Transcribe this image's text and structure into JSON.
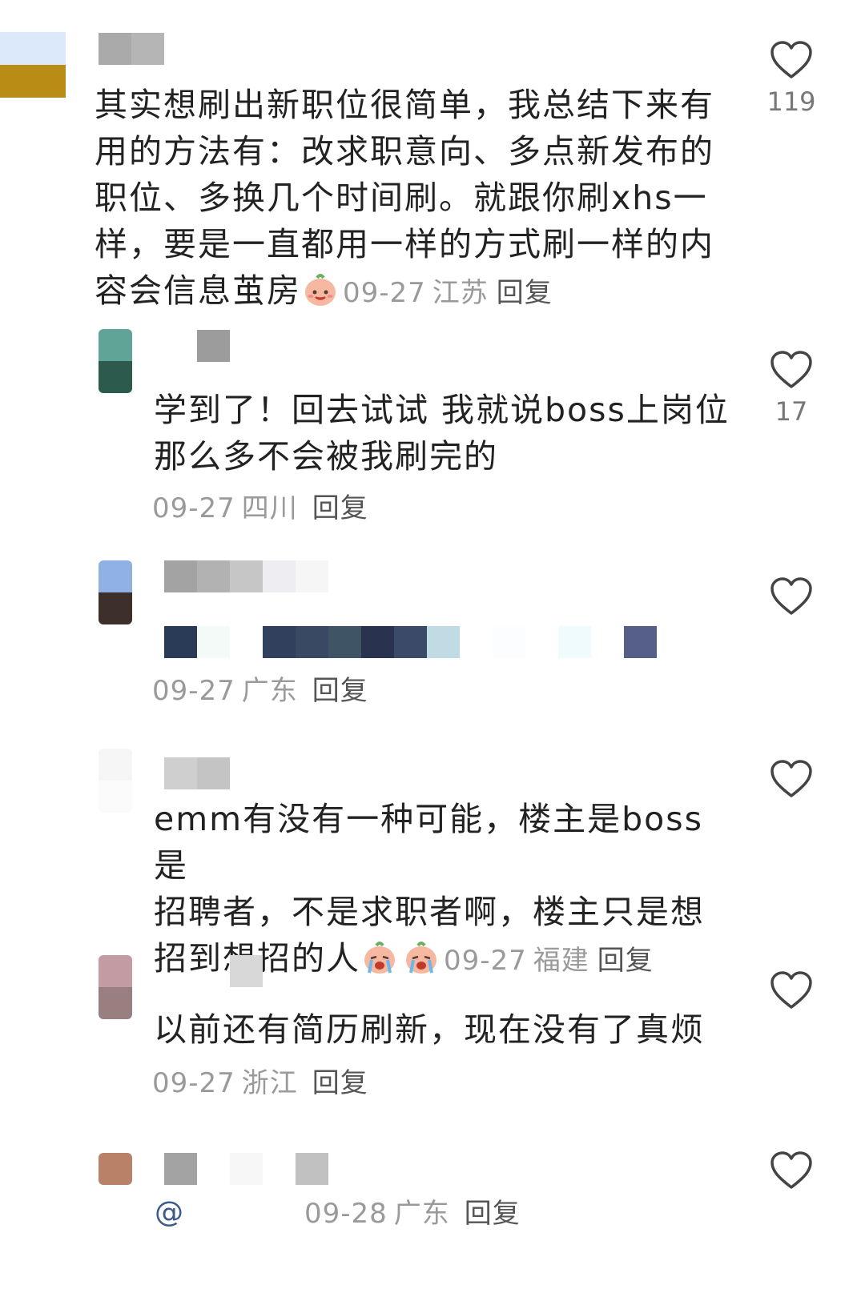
{
  "comments": [
    {
      "text_lines": [
        "其实想刷出新职位很简单，我总结下来有",
        "用的方法有：改求职意向、多点新发布的",
        "职位、多换几个时间刷。就跟你刷xhs一",
        "样，要是一直都用一样的方式刷一样的内"
      ],
      "last_line": "容会信息茧房",
      "emoji": "smiling-peach-emoji",
      "date": "09-27",
      "region": "江苏",
      "reply_label": "回复",
      "likes": "119",
      "avatar_colors": [
        "#dbe9fb",
        "#b98d15"
      ],
      "name_blur_colors": [
        "#aaaaaa",
        "#b5b5b5"
      ]
    },
    {
      "text_lines": [
        "学到了！回去试试 我就说boss上岗位",
        "那么多不会被我刷完的"
      ],
      "date": "09-27",
      "region": "四川",
      "reply_label": "回复",
      "likes": "17",
      "avatar_colors": [
        "#5fa496",
        "#2c5a4d"
      ],
      "name_blur_colors": [
        "#9c9c9c"
      ]
    },
    {
      "date": "09-27",
      "region": "广东",
      "reply_label": "回复",
      "likes": "",
      "avatar_colors": [
        "#8fb1e3",
        "#3d2f2a"
      ],
      "name_blur_colors": [
        "#a3a3a3",
        "#b2b2b2",
        "#c6c6c6",
        "#ededf2",
        "#f6f6f6"
      ],
      "content_blur_colors": [
        "#2a3b57",
        "#f3faf7",
        "#ffffff",
        "#30405d",
        "#3a4963",
        "#3f5566",
        "#29334f",
        "#3b4a69",
        "#c1dbe4",
        "#ffffff",
        "#fbfdff",
        "#ffffff",
        "#f0fbfd",
        "#ffffff",
        "#555f87"
      ]
    },
    {
      "text_lines": [
        "emm有没有一种可能，楼主是boss是",
        "招聘者，不是求职者啊，楼主只是想"
      ],
      "last_line": "招到想招的人",
      "emoji": "crying-peach-emoji",
      "date": "09-27",
      "region": "福建",
      "reply_label": "回复",
      "likes": "",
      "avatar_colors": [
        "#f6f6f6",
        "#fbfbfb"
      ],
      "name_blur_colors": [
        "#cfcfcf",
        "#c4c4c4"
      ]
    },
    {
      "text_lines": [
        "以前还有简历刷新，现在没有了真烦"
      ],
      "date": "09-27",
      "region": "浙江",
      "reply_label": "回复",
      "likes": "",
      "avatar_colors": [
        "#c29ba3",
        "#9a7f80"
      ],
      "name_blur_colors": [
        "#d8d8d8"
      ]
    },
    {
      "at_symbol": "@",
      "date": "09-28",
      "region": "广东",
      "reply_label": "回复",
      "likes": "",
      "avatar_colors": [
        "#b98168",
        "#ffffff"
      ],
      "name_blur_colors": [
        "#a3a3a3",
        "#ffffff",
        "#f7f7f7",
        "#ffffff",
        "#c1c1c1"
      ]
    }
  ],
  "colors": {
    "text": "#222222",
    "meta": "#9a9a9a",
    "reply": "#555555",
    "like_icon": "#444444"
  }
}
